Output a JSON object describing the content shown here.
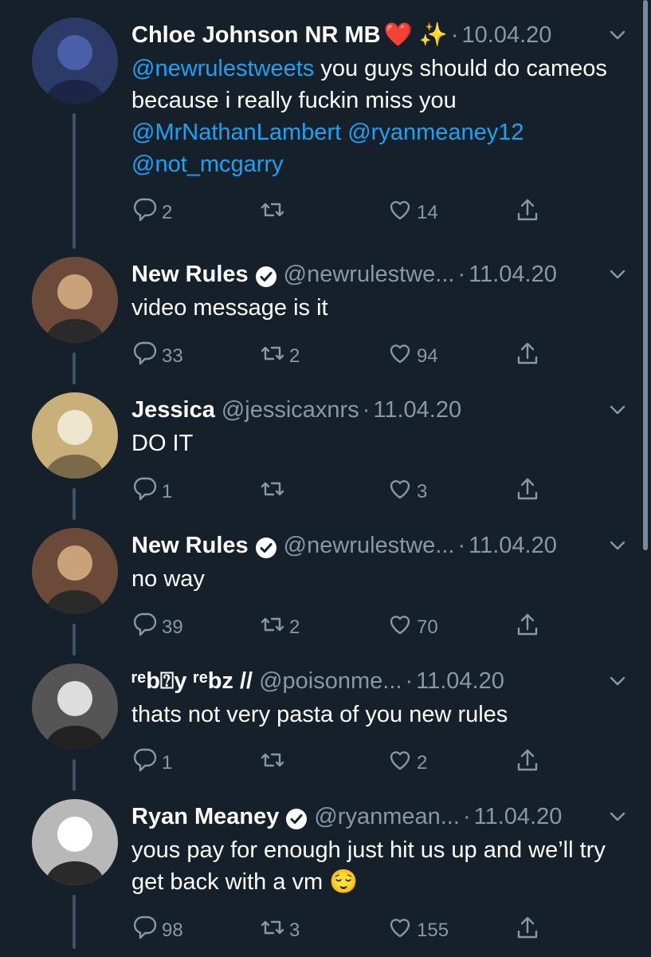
{
  "colors": {
    "background": "#15202b",
    "text": "#ffffff",
    "secondary": "#8899a6",
    "mention": "#1da1f2",
    "thread_line": "#3d5466"
  },
  "tweets": [
    {
      "name": "Chloe Johnson NR MB",
      "name_emoji": "❤️ ✨",
      "handle": "",
      "separator": "·",
      "date": "10.04.20",
      "verified": false,
      "text_parts": [
        {
          "t": "@newrulestweets",
          "mention": true
        },
        {
          "t": " you guys should do cameos because i really fuckin miss you ",
          "mention": false
        },
        {
          "t": "@MrNathanLambert",
          "mention": true
        },
        {
          "t": " ",
          "mention": false
        },
        {
          "t": "@ryanmeaney12",
          "mention": true
        },
        {
          "t": " ",
          "mention": false
        },
        {
          "t": "@not_mcgarry",
          "mention": true
        }
      ],
      "replies": "2",
      "retweets": "",
      "likes": "14",
      "icons": [
        "reply-icon",
        "retweet-icon",
        "like-icon",
        "share-icon"
      ]
    },
    {
      "name": "New Rules",
      "handle": "@newrulestwe...",
      "separator": "·",
      "date": "11.04.20",
      "verified": true,
      "text": "video message is it",
      "replies": "33",
      "retweets": "2",
      "likes": "94"
    },
    {
      "name": "Jessica",
      "handle": "@jessicaxnrs",
      "separator": "·",
      "date": "11.04.20",
      "verified": false,
      "text": "DO IT",
      "replies": "1",
      "retweets": "",
      "likes": "3"
    },
    {
      "name": "New Rules",
      "handle": "@newrulestwe...",
      "separator": "·",
      "date": "11.04.20",
      "verified": true,
      "text": "no way",
      "replies": "39",
      "retweets": "2",
      "likes": "70"
    },
    {
      "name": "ʳᵉb⍰y ʳᵉbz //",
      "handle": "@poisonme...",
      "separator": "·",
      "date": "11.04.20",
      "verified": false,
      "text": "thats not very pasta of you new rules",
      "replies": "1",
      "retweets": "",
      "likes": "2"
    },
    {
      "name": "Ryan Meaney",
      "handle": "@ryanmean...",
      "separator": "·",
      "date": "11.04.20",
      "verified": true,
      "text": "yous pay for enough just hit us up and we’ll try get back with a vm 😌",
      "replies": "98",
      "retweets": "3",
      "likes": "155"
    }
  ]
}
